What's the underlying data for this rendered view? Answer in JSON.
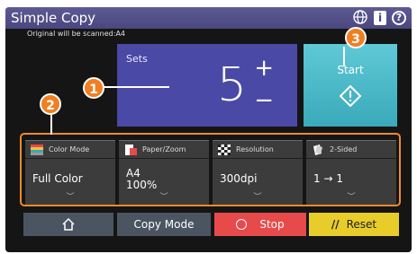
{
  "header": {
    "app_title": "Simple Copy",
    "icons": [
      "globe-icon",
      "info-icon",
      "help-icon"
    ]
  },
  "status": {
    "scan_note": "Original will be scanned:A4"
  },
  "sets": {
    "label": "Sets",
    "value": "5",
    "plus": "+",
    "minus": "−"
  },
  "start": {
    "label": "Start",
    "icon": "start-diamond-icon"
  },
  "functions": [
    {
      "label": "Color Mode",
      "value": "Full Color",
      "icon": "color-mode-icon"
    },
    {
      "label": "Paper/Zoom",
      "value_line1": "A4",
      "value_line2": "100%",
      "icon": "paper-zoom-icon"
    },
    {
      "label": "Resolution",
      "value": "300dpi",
      "icon": "resolution-icon"
    },
    {
      "label": "2-Sided",
      "value": "1 → 1",
      "icon": "two-sided-icon"
    }
  ],
  "bottom": {
    "home_icon": "home-icon",
    "copy_mode": "Copy Mode",
    "stop": "Stop",
    "reset": "Reset"
  },
  "callouts": [
    "1",
    "2",
    "3"
  ],
  "colors": {
    "accent_orange": "#ef7f22",
    "sets_blue": "#4a49a6",
    "start_cyan": "#4cbccb",
    "stop_red": "#e74a4a",
    "reset_yellow": "#e8cc2a",
    "title_purple": "#4a4780"
  }
}
